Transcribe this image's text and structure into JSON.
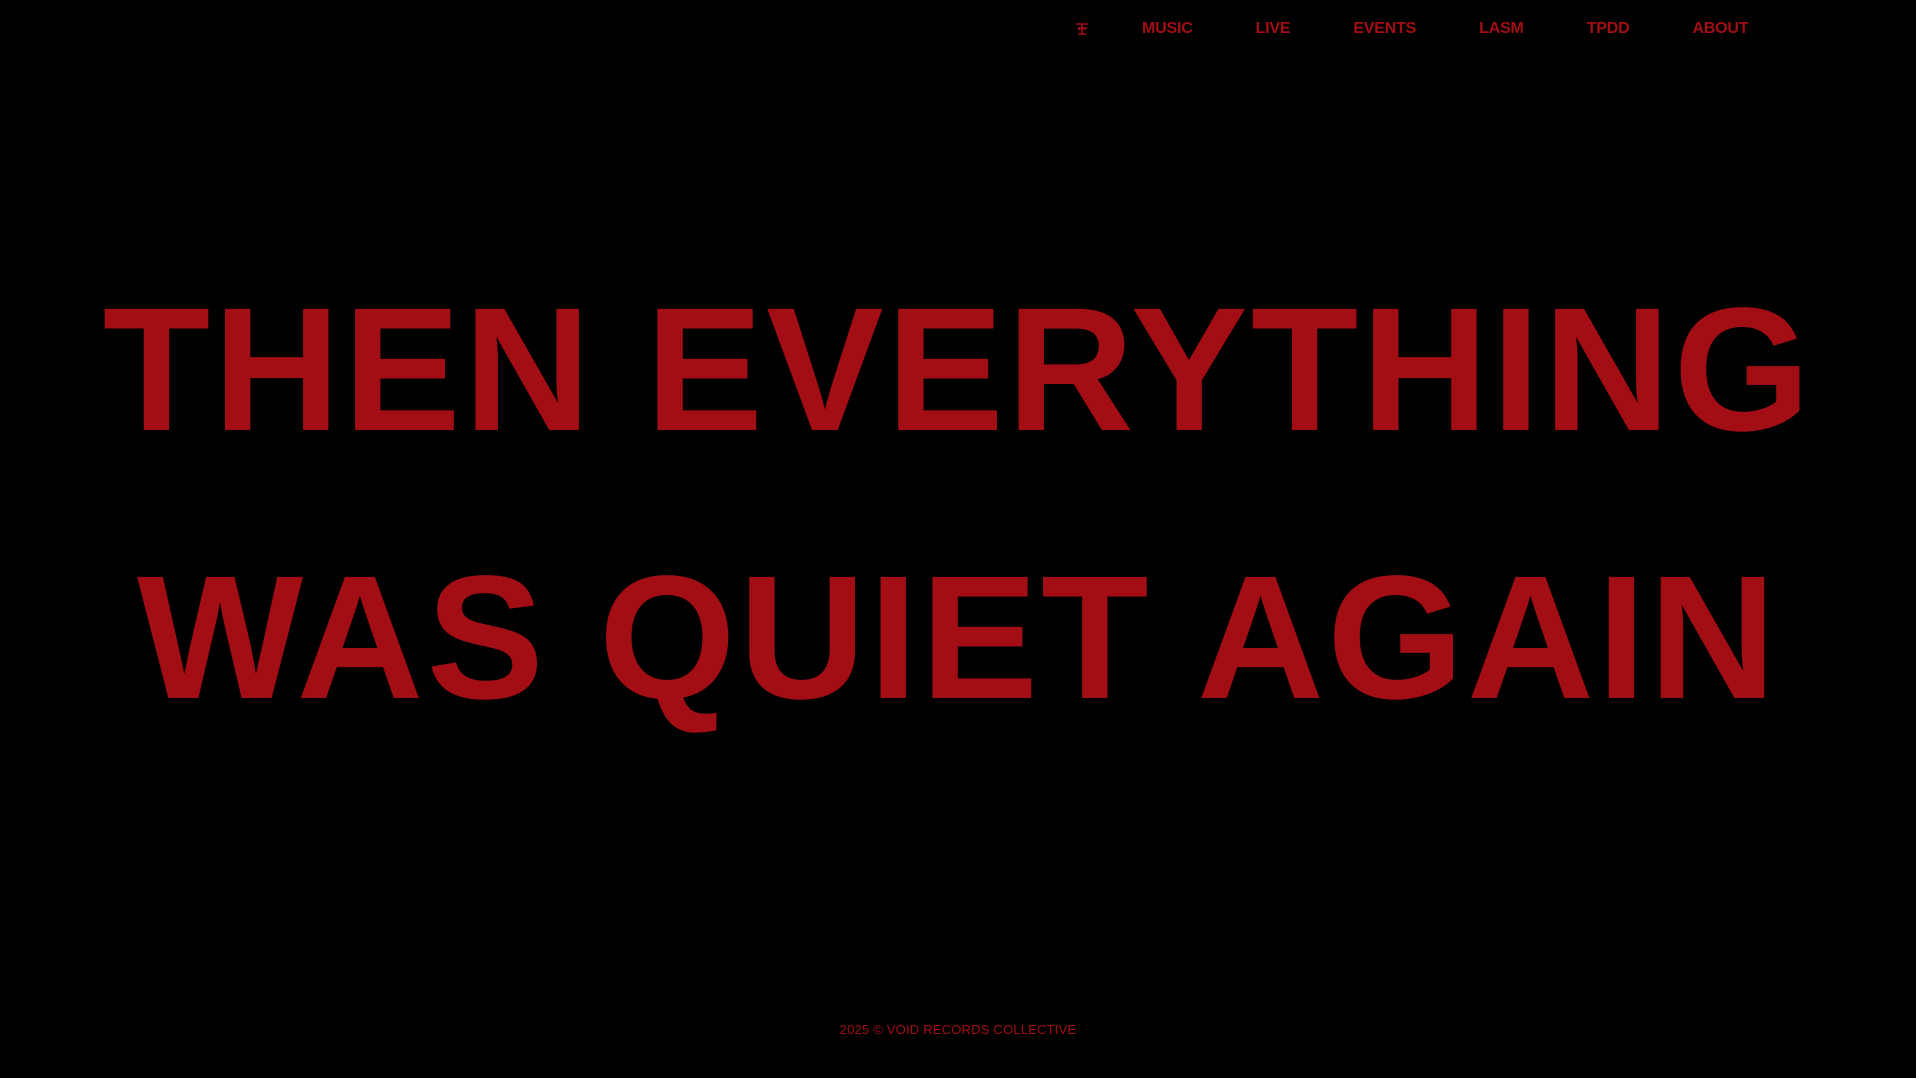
{
  "colors": {
    "background": "#000000",
    "accent": "#a20e14"
  },
  "nav": {
    "logo_icon": "label-logo-icon",
    "items": [
      {
        "label": "MUSIC"
      },
      {
        "label": "LIVE"
      },
      {
        "label": "EVENTS"
      },
      {
        "label": "LASM"
      },
      {
        "label": "TPDD"
      },
      {
        "label": "ABOUT"
      }
    ]
  },
  "hero": {
    "line1": "THEN EVERYTHING",
    "line2": "WAS QUIET AGAIN"
  },
  "footer": {
    "text": "2025 © VOID RECORDS COLLECTIVE"
  }
}
